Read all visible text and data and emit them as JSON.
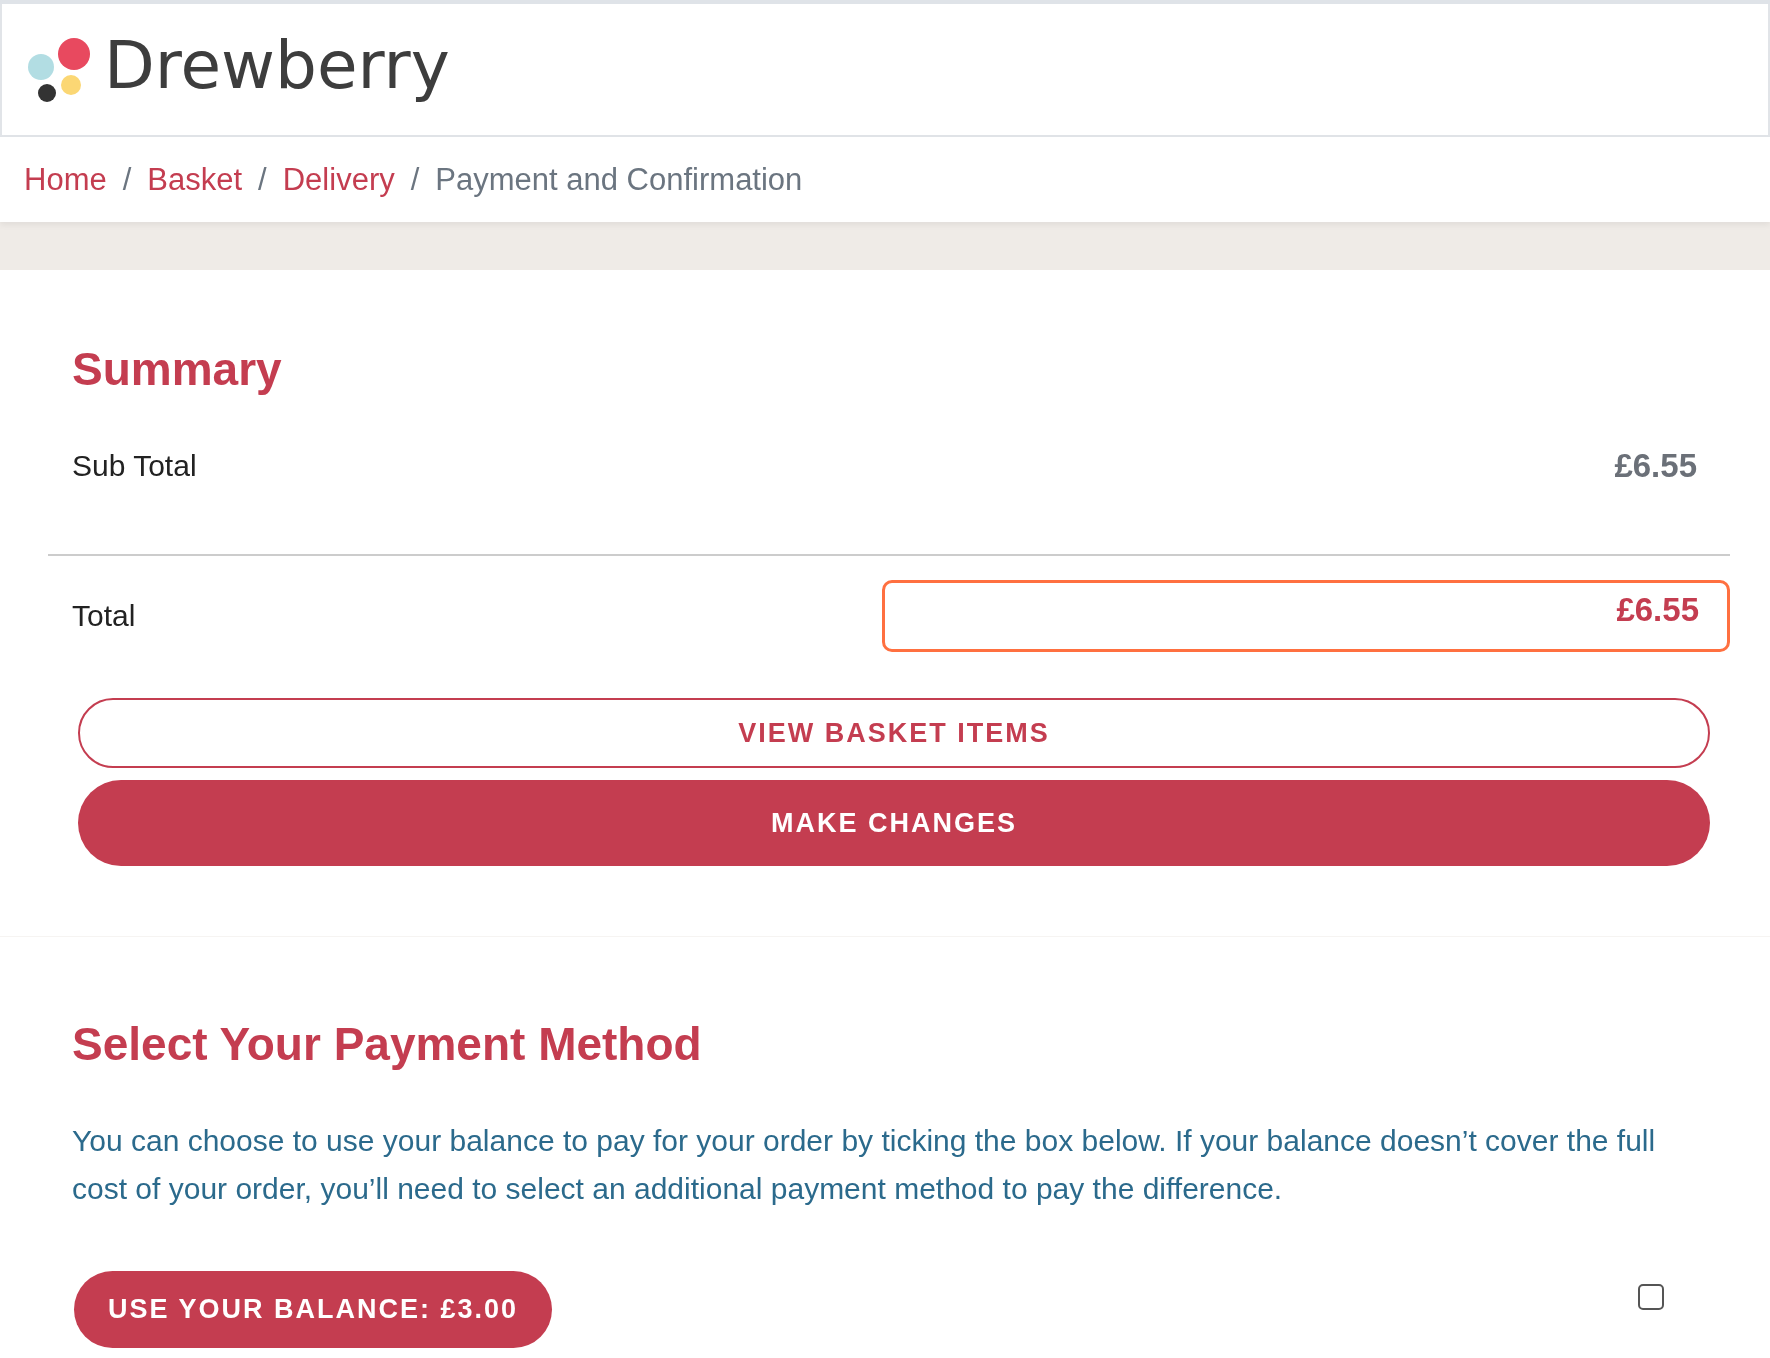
{
  "header": {
    "logo_text": "Drewberry"
  },
  "breadcrumb": [
    {
      "label": "Home",
      "kind": "link"
    },
    {
      "label": "Basket",
      "kind": "link"
    },
    {
      "label": "Delivery",
      "kind": "link"
    },
    {
      "label": "Payment and Confirmation",
      "kind": "current"
    }
  ],
  "separator": "/",
  "summary": {
    "title": "Summary",
    "sub_total_label": "Sub Total",
    "sub_total": "£6.55",
    "total_label": "Total",
    "total": "£6.55",
    "buttons": [
      {
        "label": "VIEW BASKET ITEMS",
        "kind": "outline"
      },
      {
        "label": "MAKE CHANGES",
        "kind": "filled"
      }
    ]
  },
  "payment": {
    "title": "Select Your Payment Method",
    "description": "You can choose to use your balance to pay for your order by ticking the box below. If your balance doesn’t cover the full cost of your order, you’ll need to select an additional payment method to pay the difference.",
    "balance_button": "USE YOUR BALANCE: £3.00",
    "use_balance": {
      "checked": false
    }
  }
}
